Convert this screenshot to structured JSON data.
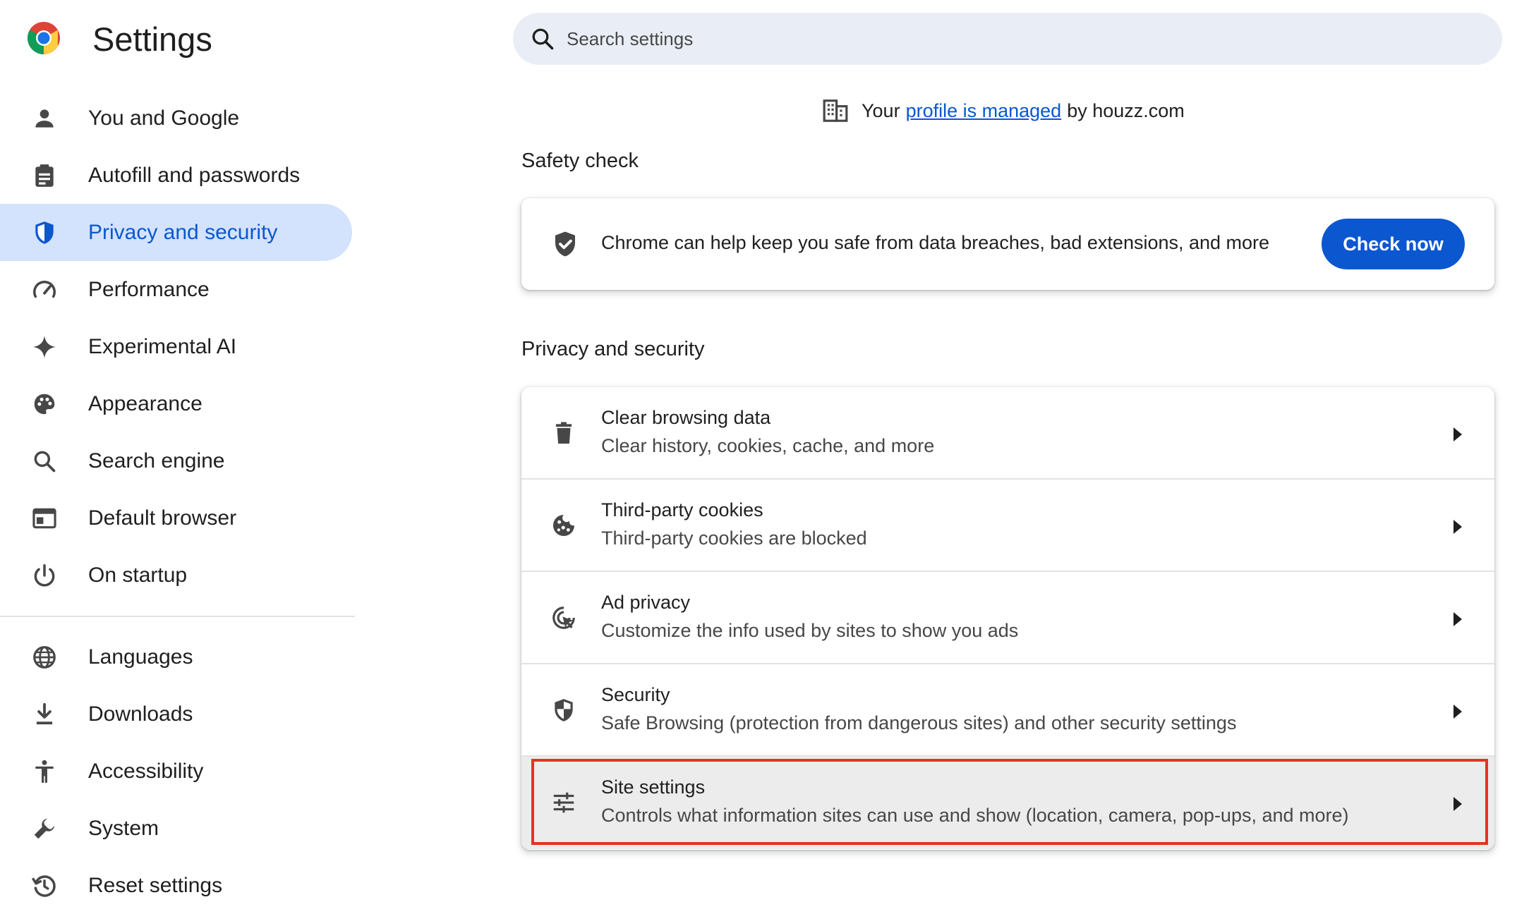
{
  "app": {
    "title": "Settings"
  },
  "search": {
    "placeholder": "Search settings"
  },
  "sidebar": {
    "items": [
      {
        "label": "You and Google",
        "icon": "person-icon"
      },
      {
        "label": "Autofill and passwords",
        "icon": "clipboard-icon"
      },
      {
        "label": "Privacy and security",
        "icon": "shield-icon",
        "active": true
      },
      {
        "label": "Performance",
        "icon": "speedometer-icon"
      },
      {
        "label": "Experimental AI",
        "icon": "sparkle-icon"
      },
      {
        "label": "Appearance",
        "icon": "palette-icon"
      },
      {
        "label": "Search engine",
        "icon": "search-icon"
      },
      {
        "label": "Default browser",
        "icon": "browser-window-icon"
      },
      {
        "label": "On startup",
        "icon": "power-icon"
      },
      {
        "label": "Languages",
        "icon": "globe-icon"
      },
      {
        "label": "Downloads",
        "icon": "download-icon"
      },
      {
        "label": "Accessibility",
        "icon": "accessibility-icon"
      },
      {
        "label": "System",
        "icon": "wrench-icon"
      },
      {
        "label": "Reset settings",
        "icon": "history-icon"
      }
    ]
  },
  "managed": {
    "prefix": "Your",
    "link": "profile is managed",
    "suffix": "by houzz.com"
  },
  "safety_check": {
    "heading": "Safety check",
    "text": "Chrome can help keep you safe from data breaches, bad extensions, and more",
    "button": "Check now"
  },
  "privacy": {
    "heading": "Privacy and security",
    "rows": [
      {
        "title": "Clear browsing data",
        "subtitle": "Clear history, cookies, cache, and more",
        "icon": "trash-icon"
      },
      {
        "title": "Third-party cookies",
        "subtitle": "Third-party cookies are blocked",
        "icon": "cookie-icon"
      },
      {
        "title": "Ad privacy",
        "subtitle": "Customize the info used by sites to show you ads",
        "icon": "ad-privacy-icon"
      },
      {
        "title": "Security",
        "subtitle": "Safe Browsing (protection from dangerous sites) and other security settings",
        "icon": "security-shield-icon"
      },
      {
        "title": "Site settings",
        "subtitle": "Controls what information sites can use and show (location, camera, pop-ups, and more)",
        "icon": "sliders-icon",
        "highlighted": true
      }
    ]
  },
  "colors": {
    "accent": "#0b57d0",
    "active_nav_bg": "#d3e3fd",
    "search_bg": "#e9eef6",
    "highlight_border": "#e53323"
  }
}
